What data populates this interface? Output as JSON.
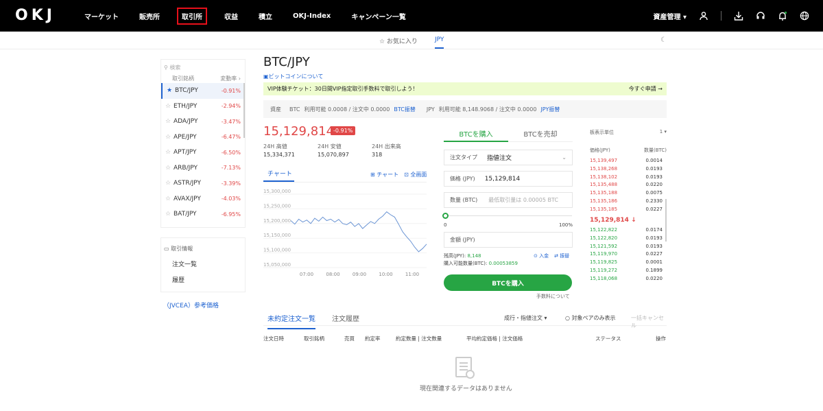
{
  "topnav": {
    "logo": [
      "O",
      "K",
      "J"
    ],
    "links": [
      "マーケット",
      "販売所",
      "取引所",
      "収益",
      "積立",
      "OKJ-Index",
      "キャンペーン一覧"
    ],
    "active_index": 2,
    "asset_menu": "資産管理 ▾"
  },
  "subtabs": {
    "favorites": "☆ お気に入り",
    "jpy": "JPY"
  },
  "sidebar": {
    "search_placeholder": "検索",
    "col_pair": "取引銘柄",
    "col_change": "変動率 ›",
    "pairs": [
      {
        "name": "BTC/JPY",
        "change": "-0.91%"
      },
      {
        "name": "ETH/JPY",
        "change": "-2.94%"
      },
      {
        "name": "ADA/JPY",
        "change": "-3.47%"
      },
      {
        "name": "APE/JPY",
        "change": "-6.47%"
      },
      {
        "name": "APT/JPY",
        "change": "-6.50%"
      },
      {
        "name": "ARB/JPY",
        "change": "-7.13%"
      },
      {
        "name": "ASTR/JPY",
        "change": "-3.39%"
      },
      {
        "name": "AVAX/JPY",
        "change": "-4.03%"
      },
      {
        "name": "BAT/JPY",
        "change": "-6.95%"
      }
    ],
    "info_title": "取引情報",
    "info_items": [
      "注文一覧",
      "履歴"
    ],
    "jvcea_link": "（JVCEA）参考価格"
  },
  "header": {
    "pair": "BTC/JPY",
    "about": "ビットコインについて",
    "vip_text": "VIP体験チケット：30日間VIP指定取引手数料で取引しよう！",
    "vip_apply": "今すぐ申請 →"
  },
  "assets": {
    "label": "資産",
    "btc_label": "BTC",
    "btc_text": "利用可能 0.0008 / 注文中 0.0000",
    "btc_link": "BTC振替",
    "jpy_label": "JPY",
    "jpy_text": "利用可能 8,148.9068 / 注文中 0.0000",
    "jpy_link": "JPY振替"
  },
  "ticker": {
    "price": "15,129,814",
    "change_badge": "-0.91%",
    "high_label": "24H 高値",
    "high": "15,334,371",
    "low_label": "24H 安値",
    "low": "15,070,897",
    "vol_label": "24H 出来高",
    "vol": "318"
  },
  "chart_tabs": {
    "chart": "チャート",
    "chart_link": "⊞ チャート",
    "full_link": "⊡ 全画面"
  },
  "chart_data": {
    "type": "line",
    "title": "",
    "xlabel": "",
    "ylabel": "",
    "x_ticks": [
      "07:00",
      "08:00",
      "09:00",
      "10:00",
      "11:00"
    ],
    "y_ticks": [
      "15,300,000",
      "15,250,000",
      "15,200,000",
      "15,150,000",
      "15,100,000",
      "15,050,000"
    ],
    "ylim": [
      15050000,
      15300000
    ],
    "series": [
      {
        "values": [
          15210000,
          15198000,
          15215000,
          15205000,
          15212000,
          15200000,
          15218000,
          15208000,
          15222000,
          15210000,
          15215000,
          15205000,
          15214000,
          15200000,
          15196000,
          15205000,
          15190000,
          15200000,
          15183000,
          15195000,
          15207000,
          15200000,
          15215000,
          15225000,
          15240000,
          15230000,
          15222000,
          15198000,
          15172000,
          15155000,
          15140000,
          15120000,
          15104000,
          15115000,
          15130000
        ]
      }
    ],
    "color": "#6a94d4"
  },
  "trade": {
    "buy_tab": "BTCを購入",
    "sell_tab": "BTCを売却",
    "order_type_label": "注文タイプ",
    "order_type_value": "指値注文",
    "price_label": "価格 (JPY)",
    "price_value": "15,129,814",
    "qty_label": "数量 (BTC)",
    "qty_placeholder": "最低取引量は 0.00005 BTC",
    "slider_min": "0",
    "slider_max": "100%",
    "slider_value": 0,
    "amount_label": "金額 (JPY)",
    "balance_label": "残高(JPY):",
    "balance_value": "8,148",
    "buyable_label": "購入可能数量(BTC):",
    "buyable_value": "0.00053859",
    "deposit_link": "⊙ 入金",
    "transfer_link": "⇄ 振替",
    "buy_button": "BTCを購入",
    "fee_link": "手数料について"
  },
  "orderbook": {
    "unit_label": "板表示単位",
    "unit_value": "1 ▾",
    "col_price": "価格(JPY)",
    "col_qty": "数量(BTC)",
    "asks": [
      {
        "price": "15,139,497",
        "qty": "0.0014"
      },
      {
        "price": "15,138,268",
        "qty": "0.0193"
      },
      {
        "price": "15,138,102",
        "qty": "0.0193"
      },
      {
        "price": "15,135,488",
        "qty": "0.0220"
      },
      {
        "price": "15,135,188",
        "qty": "0.0075"
      },
      {
        "price": "15,135,186",
        "qty": "0.2330"
      },
      {
        "price": "15,135,185",
        "qty": "0.0227"
      }
    ],
    "last": "15,129,814 ↓",
    "bids": [
      {
        "price": "15,122,822",
        "qty": "0.0174"
      },
      {
        "price": "15,122,820",
        "qty": "0.0193"
      },
      {
        "price": "15,121,592",
        "qty": "0.0193"
      },
      {
        "price": "15,119,970",
        "qty": "0.0227"
      },
      {
        "price": "15,119,825",
        "qty": "0.0001"
      },
      {
        "price": "15,119,272",
        "qty": "0.1899"
      },
      {
        "price": "15,118,068",
        "qty": "0.0220"
      }
    ]
  },
  "orders": {
    "tab_open": "未約定注文一覧",
    "tab_history": "注文履歴",
    "filter_type": "成行・指値注文 ▾",
    "filter_pair_only": "○ 対象ペアのみ表示",
    "cancel_all": "一括キャンセル",
    "columns": [
      "注文日時",
      "取引銘柄",
      "売買",
      "約定率",
      "約定数量 | 注文数量",
      "平均約定価格 | 注文価格",
      "ステータス",
      "操作"
    ],
    "empty": "現在関連するデータはありません"
  },
  "colors": {
    "up": "#27a544",
    "down": "#e04747",
    "accent": "#1e62d0",
    "highlight": "#e8101a"
  }
}
